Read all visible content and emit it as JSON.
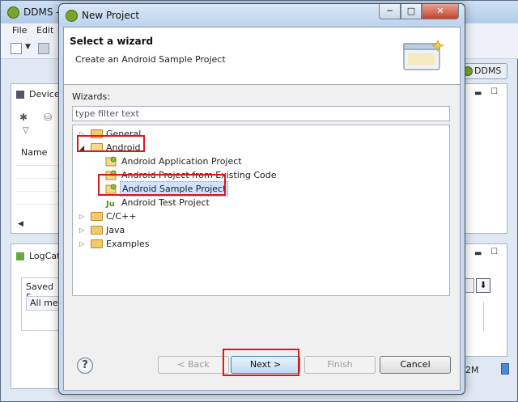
{
  "background_window": {
    "title": "DDMS -",
    "menu": [
      "File",
      "Edit"
    ],
    "perspective_button": "DDMS",
    "devices_panel": {
      "title": "Device",
      "column_name": "Name"
    },
    "logcat_panel": {
      "title": "LogCat",
      "saved_filters": "Saved F",
      "all_messages": "All me"
    },
    "memory_text": "2M"
  },
  "dialog": {
    "title": "New Project",
    "window_buttons": {
      "minimize": "─",
      "maximize": "□",
      "close": "✕"
    },
    "banner": {
      "heading": "Select a wizard",
      "description": "Create an Android Sample Project"
    },
    "wizards_label": "Wizards:",
    "filter": {
      "placeholder": "type filter text",
      "value": ""
    },
    "tree": [
      {
        "label": "General",
        "type": "folder",
        "expanded": false
      },
      {
        "label": "Android",
        "type": "folder",
        "expanded": true,
        "highlighted": true,
        "children": [
          {
            "label": "Android Application Project",
            "type": "android-project"
          },
          {
            "label": "Android Project from Existing Code",
            "type": "android-project"
          },
          {
            "label": "Android Sample Project",
            "type": "android-project",
            "selected": true,
            "highlighted": true
          },
          {
            "label": "Android Test Project",
            "type": "junit-project"
          }
        ]
      },
      {
        "label": "C/C++",
        "type": "folder",
        "expanded": false
      },
      {
        "label": "Java",
        "type": "folder",
        "expanded": false
      },
      {
        "label": "Examples",
        "type": "folder",
        "expanded": false
      }
    ],
    "buttons": {
      "help": "?",
      "back": "< Back",
      "next": "Next >",
      "finish": "Finish",
      "cancel": "Cancel"
    }
  },
  "colors": {
    "highlight": "#e0161b",
    "selection": "#cfe3fb",
    "folder": "#f2c96b",
    "android_green": "#7aa52b"
  }
}
